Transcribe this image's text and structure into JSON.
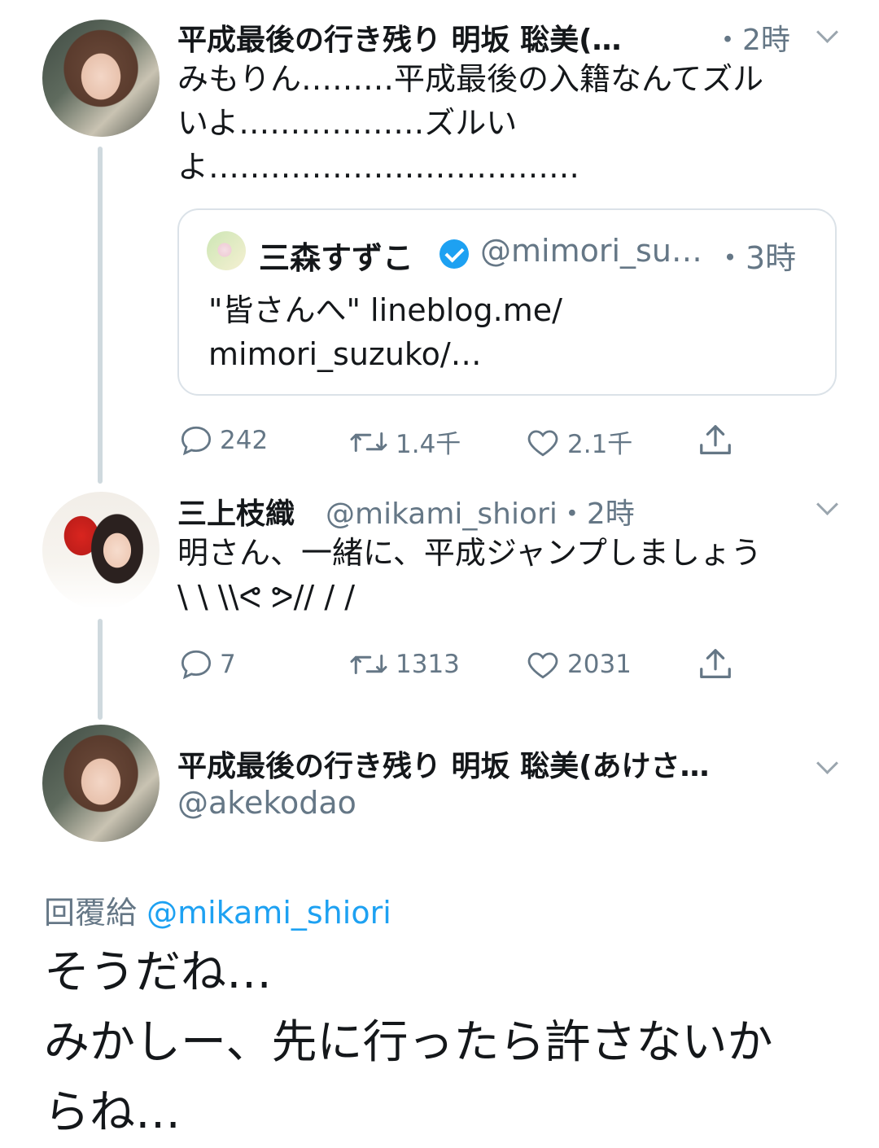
{
  "tweet1": {
    "display_name": "平成最後の行き残り 明坂 聡美(…",
    "time": "・2時",
    "text_line1": "みもりん………平成最後の入籍なんてズル",
    "text_line2": "いよ………………ズルい",
    "text_line3": "よ………………………………",
    "quote": {
      "name": "三森すずこ",
      "handle": "@mimori_su…",
      "time": "・3時",
      "text_line1": "\"皆さんへ\"  lineblog.me/",
      "text_line2": "mimori_suzuko/…"
    },
    "actions": {
      "replies": "242",
      "retweets": "1.4千",
      "likes": "2.1千"
    }
  },
  "tweet2": {
    "display_name": "三上枝織",
    "handle_time": "@mikami_shiori・2時",
    "text_line1": "明さん、一緒に、平成ジャンプしましょう",
    "text_line2": "\\ \\ \\\\ᕙ ᕗ// /  /",
    "actions": {
      "replies": "7",
      "retweets": "1313",
      "likes": "2031"
    }
  },
  "main_tweet": {
    "display_name": "平成最後の行き残り 明坂 聡美(あけさ…",
    "handle": "@akekodao",
    "reply_prefix": "回覆給",
    "reply_to": "@mikami_shiori",
    "text_line1": "そうだね…",
    "text_line2": "みかしー、先に行ったら許さないか",
    "text_line3": "らね…"
  },
  "colors": {
    "accent": "#1da1f2",
    "muted": "#657786",
    "text": "#14171a",
    "thread_line": "#cfd9de"
  },
  "icons": [
    "reply-icon",
    "retweet-icon",
    "like-icon",
    "share-icon",
    "chevron-down-icon",
    "verified-badge-icon"
  ]
}
